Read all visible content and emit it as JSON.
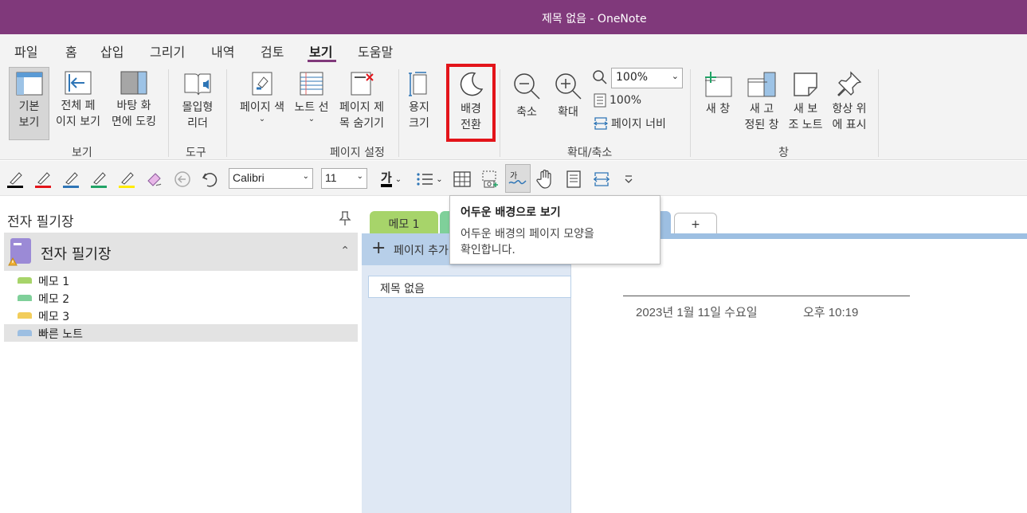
{
  "window": {
    "title": "제목 없음  -  OneNote"
  },
  "menu": {
    "items": [
      "파일",
      "홈",
      "삽입",
      "그리기",
      "내역",
      "검토",
      "보기",
      "도움말"
    ],
    "active": "보기"
  },
  "ribbon": {
    "view": {
      "normal": "기본\n보기",
      "fullpage": "전체 페\n이지 보기",
      "dock": "바탕 화\n면에 도킹",
      "group": "보기"
    },
    "tools": {
      "immersive": "몰입형\n리더",
      "group": "도구"
    },
    "page_setup": {
      "page_color": "페이지 색",
      "rule_lines": "노트 선",
      "hide_title": "페이지 제\n목 숨기기",
      "paper_size": "용지\n크기",
      "switch_bg": "배경\n전환",
      "group": "페이지 설정"
    },
    "zoom": {
      "zoom_out": "축소",
      "zoom_in": "확대",
      "zoom_value": "100%",
      "zoom_100": "100%",
      "page_width": "페이지 너비",
      "group": "확대/축소"
    },
    "window": {
      "new_window": "새 창",
      "new_docked": "새 고\n정된 창",
      "new_side": "새 보\n조 노트",
      "always_top": "항상 위\n에 표시",
      "group": "창"
    }
  },
  "toolbar": {
    "font": "Calibri",
    "size": "11",
    "font_color_glyph": "가"
  },
  "sidebar": {
    "header": "전자 필기장",
    "notebook": "전자 필기장",
    "sections": [
      {
        "label": "메모 1",
        "color": "#a7d46a"
      },
      {
        "label": "메모 2",
        "color": "#7fd09a"
      },
      {
        "label": "메모 3",
        "color": "#f2cd5b"
      },
      {
        "label": "빠른 노트",
        "color": "#9dbfe2"
      }
    ]
  },
  "tabs": {
    "first": "메모 1",
    "add": "+"
  },
  "pages": {
    "add_label": "페이지 추가",
    "items": [
      "제목 없음"
    ]
  },
  "page": {
    "date": "2023년 1월 11일 수요일",
    "time": "오후 10:19"
  },
  "tooltip": {
    "title": "어두운 배경으로 보기",
    "desc": "어두운 배경의 페이지 모양을\n확인합니다."
  },
  "colors": {
    "title_bar": "#80397b",
    "highlight": "#e3141a",
    "section_blue": "#9dbfe2"
  }
}
